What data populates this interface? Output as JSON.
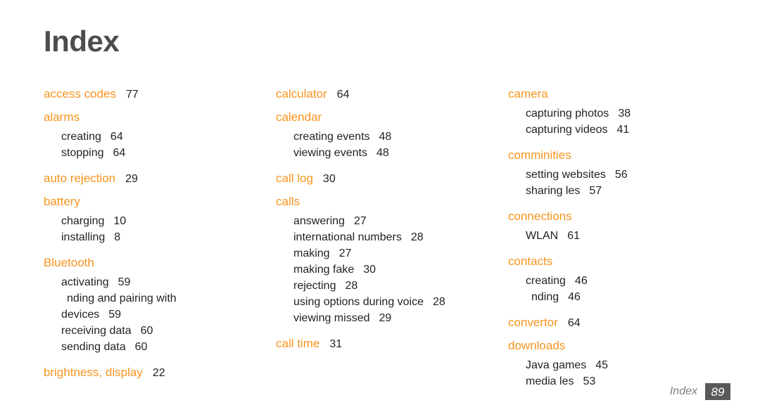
{
  "page": {
    "title": "Index",
    "accent_color": "#F7941E",
    "title_color": "#4D4D4D",
    "text_color": "#231F20",
    "background": "#FFFFFF"
  },
  "footer": {
    "label": "Index",
    "page_number": "89",
    "badge_color": "#595959"
  },
  "columns": [
    {
      "id": "column-1",
      "entries": [
        {
          "type": "main",
          "term": "access codes",
          "page": "77"
        },
        {
          "type": "main",
          "term": "alarms",
          "page": ""
        },
        {
          "type": "sub",
          "term": "creating",
          "page": "64"
        },
        {
          "type": "sub",
          "term": "stopping",
          "page": "64"
        },
        {
          "type": "main",
          "term": "auto rejection",
          "page": "29"
        },
        {
          "type": "main",
          "term": "battery",
          "page": ""
        },
        {
          "type": "sub",
          "term": "charging",
          "page": "10"
        },
        {
          "type": "sub",
          "term": "installing",
          "page": "8"
        },
        {
          "type": "main",
          "term": "Bluetooth",
          "page": ""
        },
        {
          "type": "sub",
          "term": "activating",
          "page": "59"
        },
        {
          "type": "sub-wrap",
          "term": "nding and pairing with",
          "page": ""
        },
        {
          "type": "sub-wrap-cont",
          "term": "devices",
          "page": "59"
        },
        {
          "type": "sub",
          "term": "receiving data",
          "page": "60"
        },
        {
          "type": "sub",
          "term": "sending data",
          "page": "60"
        },
        {
          "type": "main",
          "term": "brightness, display",
          "page": "22"
        }
      ]
    },
    {
      "id": "column-2",
      "entries": [
        {
          "type": "main",
          "term": "calculator",
          "page": "64"
        },
        {
          "type": "main",
          "term": "calendar",
          "page": ""
        },
        {
          "type": "sub",
          "term": "creating events",
          "page": "48"
        },
        {
          "type": "sub",
          "term": "viewing events",
          "page": "48"
        },
        {
          "type": "main",
          "term": "call log",
          "page": "30"
        },
        {
          "type": "main",
          "term": "calls",
          "page": ""
        },
        {
          "type": "sub",
          "term": "answering",
          "page": "27"
        },
        {
          "type": "sub",
          "term": "international numbers",
          "page": "28"
        },
        {
          "type": "sub",
          "term": "making",
          "page": "27"
        },
        {
          "type": "sub",
          "term": "making fake",
          "page": "30"
        },
        {
          "type": "sub",
          "term": "rejecting",
          "page": "28"
        },
        {
          "type": "sub",
          "term": "using options during voice",
          "page": "28"
        },
        {
          "type": "sub",
          "term": "viewing missed",
          "page": "29"
        },
        {
          "type": "main",
          "term": "call time",
          "page": "31"
        }
      ]
    },
    {
      "id": "column-3",
      "entries": [
        {
          "type": "main",
          "term": "camera",
          "page": ""
        },
        {
          "type": "sub",
          "term": "capturing photos",
          "page": "38"
        },
        {
          "type": "sub",
          "term": "capturing videos",
          "page": "41"
        },
        {
          "type": "main",
          "term": "comminities",
          "page": ""
        },
        {
          "type": "sub",
          "term": "setting websites",
          "page": "56"
        },
        {
          "type": "sub",
          "term": "sharing  les",
          "page": "57"
        },
        {
          "type": "main",
          "term": "connections",
          "page": ""
        },
        {
          "type": "sub",
          "term": "WLAN",
          "page": "61"
        },
        {
          "type": "main",
          "term": "contacts",
          "page": ""
        },
        {
          "type": "sub",
          "term": "creating",
          "page": "46"
        },
        {
          "type": "sub-wrap",
          "term": "nding",
          "page": "46"
        },
        {
          "type": "main",
          "term": "convertor",
          "page": "64"
        },
        {
          "type": "main",
          "term": "downloads",
          "page": ""
        },
        {
          "type": "sub",
          "term": "Java games",
          "page": "45"
        },
        {
          "type": "sub",
          "term": "media  les",
          "page": "53"
        }
      ]
    }
  ]
}
